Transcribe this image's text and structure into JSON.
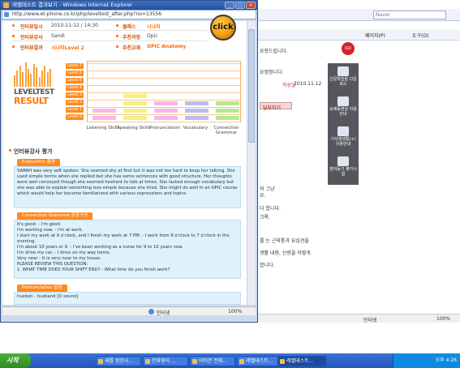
{
  "popup": {
    "title": "레벨테스트 결과보기 - Windows Internet Explorer",
    "url": "http://www.et-phone.co.kr/php/leveltest_after.php?no=13556",
    "status_zone": "인터넷",
    "zoom": "100%"
  },
  "info": {
    "row1": {
      "label1": "인터뷰일시",
      "value1": "2010-11-12 / 14:30",
      "label2": "클래스",
      "value2": "시나미"
    },
    "row2": {
      "label1": "인터뷰강사",
      "value1": "Sandi",
      "label2": "추천과정",
      "value2": "Opic"
    },
    "row3": {
      "label1": "인터뷰결과",
      "value1": "시나미Level 2",
      "label2": "추천교재",
      "value2": "OPIC Anatomy"
    },
    "click_label": "click"
  },
  "result": {
    "logo_line1": "LEVELTEST",
    "logo_line2": "RESULT",
    "levels": [
      "Level 7",
      "Level 6",
      "Level 5",
      "Level 4",
      "Level 3",
      "Level 2",
      "Level 1",
      "Level 0"
    ]
  },
  "chart_data": {
    "type": "bar",
    "categories": [
      "Listening Skills",
      "Speaking Skills",
      "Pronunciation",
      "Vocabulary",
      "Connection Grammar"
    ],
    "values": [
      2,
      4,
      3,
      3,
      3
    ],
    "ylim": [
      0,
      7
    ],
    "colors": [
      "#f9b8e4",
      "#f7ef8a",
      "#f7b6e7",
      "#bbbdf0",
      "#b8e88e"
    ]
  },
  "sections": {
    "title": "인터뷰강사 평가",
    "evaluation_tab": "Evaluation 총평",
    "evaluation_text": "SARAH was very soft spoken. She seemed shy at first but it was not too hard to keep her talking. She used simple terms when she replied but she has some sentences with good structure. Her thoughts were well conveyed though she seemed hesitant to talk at times. She lacked enough vocabulary but she was able to explain something less simple because she tried. She might do well in an OPIC course which would help her become familiarized with various expressions and topics.",
    "grammar_tab": "Connection Grammar 문장구성",
    "grammar_lines": [
      "It's good. - I'm good.",
      "I'm working now. - I'm at work.",
      "I start my work at 9 o'clock, and I finish my work at 7 PM. - I work from 9 o'clock to 7 o'clock in the evening.",
      "I'm about 10 years or 9. - I've been working as a nurse for 9 to 10 years now.",
      "I'm drive my car. - I drive on my way home.",
      "Very near - It is very near to my house.",
      "PLEASE REVIEW THIS QUESTION:",
      "1. WHAT TIME DOES YOUR SHIFT END? - What time do you finish work?"
    ],
    "pronunciation_tab": "Pronunciation 발음",
    "pronunciation_text": "husbon - husband [D sound]"
  },
  "background": {
    "search_placeholder": "Naver",
    "toolbar_page": "페이지(P)",
    "toolbar_tools": "도구(O)",
    "writer_label": "작성일",
    "writer_date": "2010.11.12",
    "btn_label": "답부하기",
    "side_items": [
      "신문학습을 다운로드",
      "숙제동영상 이용안내",
      "기사생생통(+) 이용안내",
      "영어듣기 평가시험"
    ],
    "texts": [
      "요청드립니다.",
      "요정정니다.",
      "의 그냥",
      "요.",
      "크록.",
      "다 합니다.",
      "를 는 근육통과 요십견을",
      "생활 내용, 신랑을 어떻게",
      "합니다."
    ],
    "status_zone": "인터넷",
    "zoom": "100%"
  },
  "taskbar": {
    "start": "시작",
    "tasks": [
      "새롭 방잔사...",
      "전화영어 ...",
      "아티큰 전화...",
      "레벨테스트...",
      "레벨테스트..."
    ],
    "clock": "오후 4:26"
  }
}
